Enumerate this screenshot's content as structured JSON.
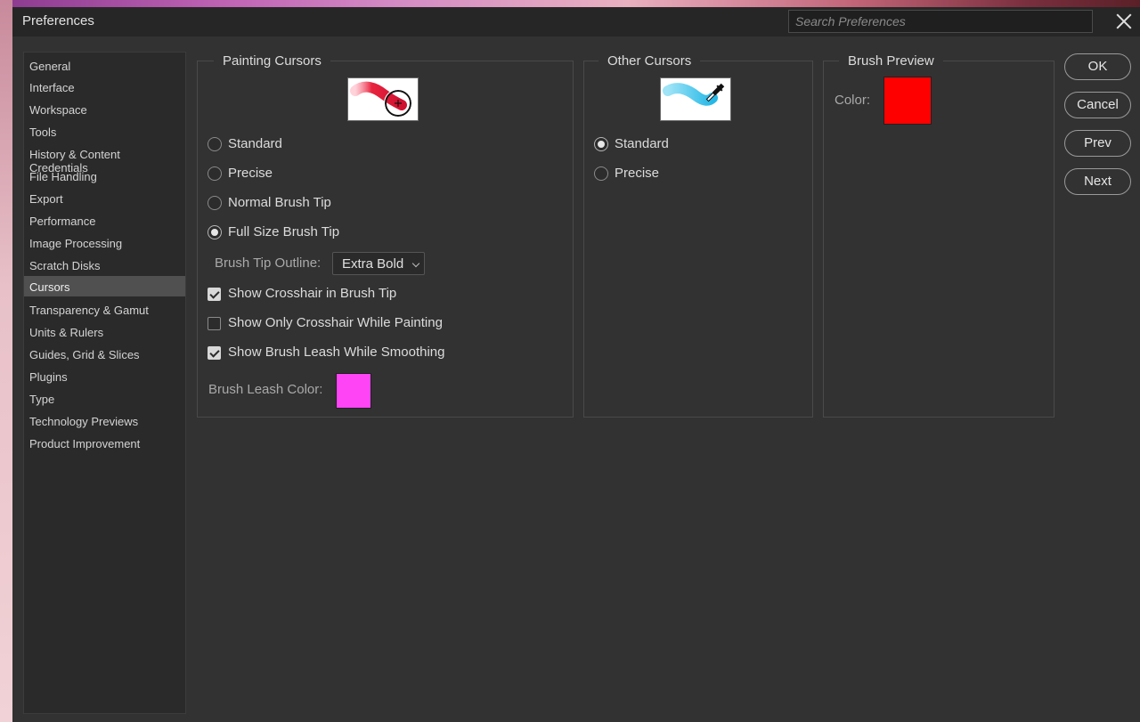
{
  "window": {
    "title": "Preferences",
    "search_placeholder": "Search Preferences"
  },
  "sidebar": {
    "items": [
      {
        "label": "General"
      },
      {
        "label": "Interface"
      },
      {
        "label": "Workspace"
      },
      {
        "label": "Tools"
      },
      {
        "label": "History & Content Credentials"
      },
      {
        "label": "File Handling"
      },
      {
        "label": "Export"
      },
      {
        "label": "Performance"
      },
      {
        "label": "Image Processing"
      },
      {
        "label": "Scratch Disks"
      },
      {
        "label": "Cursors",
        "selected": true
      },
      {
        "label": "Transparency & Gamut"
      },
      {
        "label": "Units & Rulers"
      },
      {
        "label": "Guides, Grid & Slices"
      },
      {
        "label": "Plugins"
      },
      {
        "label": "Type"
      },
      {
        "label": "Technology Previews"
      },
      {
        "label": "Product Improvement"
      }
    ]
  },
  "painting_cursors": {
    "title": "Painting Cursors",
    "options": [
      "Standard",
      "Precise",
      "Normal Brush Tip",
      "Full Size Brush Tip"
    ],
    "selected": "Full Size Brush Tip",
    "brush_tip_outline_label": "Brush Tip Outline:",
    "brush_tip_outline_value": "Extra Bold",
    "show_crosshair_label": "Show Crosshair in Brush Tip",
    "show_crosshair_checked": true,
    "show_only_crosshair_label": "Show Only Crosshair While Painting",
    "show_only_crosshair_checked": false,
    "show_leash_label": "Show Brush Leash While Smoothing",
    "show_leash_checked": true,
    "leash_color_label": "Brush Leash Color:",
    "leash_color": "#ff44f6"
  },
  "other_cursors": {
    "title": "Other Cursors",
    "options": [
      "Standard",
      "Precise"
    ],
    "selected": "Standard"
  },
  "brush_preview": {
    "title": "Brush Preview",
    "color_label": "Color:",
    "color": "#ff0000"
  },
  "buttons": {
    "ok": "OK",
    "cancel": "Cancel",
    "prev": "Prev",
    "next": "Next"
  }
}
